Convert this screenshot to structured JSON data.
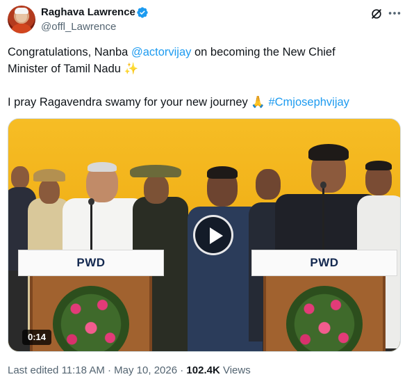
{
  "author": {
    "name": "Raghava Lawrence",
    "handle": "@offl_Lawrence",
    "verified_icon": "verified-badge-icon",
    "verified_color": "#1d9bf0"
  },
  "header_actions": {
    "grok_icon": "grok-icon",
    "more_icon": "more-icon"
  },
  "tweet": {
    "line1_prefix": "Congratulations, Nanba ",
    "mention": "@actorvijay",
    "line1_suffix": " on becoming the New Chief",
    "line2": "Minister of Tamil Nadu ",
    "sparkles": "✨",
    "line3_prefix": "I pray Ragavendra swamy for your new journey ",
    "folded_hands": "🙏",
    "hashtag": "#Cmjosephvijay"
  },
  "media": {
    "podium_left_label": "PWD",
    "podium_right_label": "PWD",
    "duration": "0:14",
    "play_icon": "play-icon"
  },
  "meta": {
    "edited_label": "Last edited",
    "time": "11:18 AM",
    "separator": "·",
    "date": "May 10, 2026",
    "views_count": "102.4K",
    "views_label": "Views"
  },
  "colors": {
    "link": "#1d9bf0",
    "text": "#0f1419",
    "secondary_text": "#536471",
    "backdrop": "#f2b316"
  }
}
